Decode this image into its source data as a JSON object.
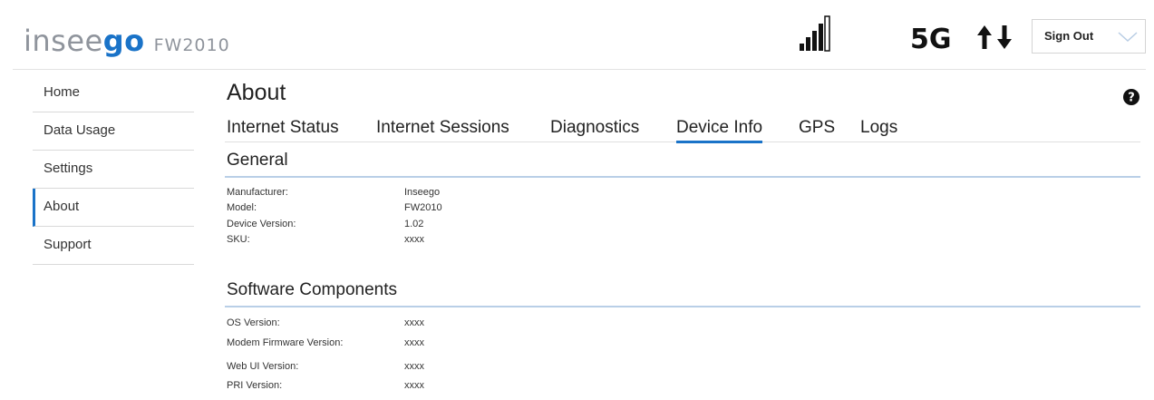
{
  "header": {
    "logo_part1": "insee",
    "logo_part2": "go",
    "model": "FW2010",
    "network": "5G",
    "sign_out_label": "Sign Out",
    "icons": [
      "signal-bars-icon",
      "upload-download-arrows-icon",
      "chevron-down-icon"
    ]
  },
  "sidebar": {
    "items": [
      {
        "label": "Home"
      },
      {
        "label": "Data Usage"
      },
      {
        "label": "Settings"
      },
      {
        "label": "About",
        "active": true
      },
      {
        "label": "Support"
      }
    ]
  },
  "main": {
    "title": "About",
    "help_icon": "question-circle-icon",
    "tabs": [
      {
        "label": "Internet Status"
      },
      {
        "label": "Internet Sessions"
      },
      {
        "label": "Diagnostics"
      },
      {
        "label": "Device Info",
        "active": true
      },
      {
        "label": "GPS"
      },
      {
        "label": "Logs"
      }
    ],
    "general": {
      "title": "General",
      "rows": [
        {
          "label": "Manufacturer:",
          "value": "Inseego"
        },
        {
          "label": "Model:",
          "value": "FW2010"
        },
        {
          "label": "Device Version:",
          "value": "1.02"
        },
        {
          "label": "SKU:",
          "value": "xxxx"
        }
      ]
    },
    "software": {
      "title": "Software Components",
      "rows": [
        {
          "label": "OS Version:",
          "value": "xxxx"
        },
        {
          "label": "Modem Firmware Version:",
          "value": "xxxx"
        },
        {
          "label": "Web UI Version:",
          "value": "xxxx"
        },
        {
          "label": "PRI Version:",
          "value": "xxxx"
        }
      ]
    }
  },
  "colors": {
    "accent": "#1a73c8",
    "logo_gray": "#8f949c",
    "section_line": "#b9cfe7"
  }
}
